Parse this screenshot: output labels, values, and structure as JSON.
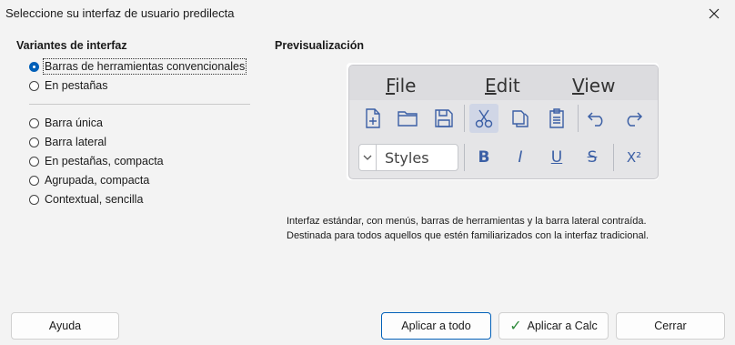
{
  "window": {
    "title": "Seleccione su interfaz de usuario predilecta"
  },
  "variants": {
    "heading": "Variantes de interfaz",
    "group1": [
      {
        "label": "Barras de herramientas convencionales",
        "checked": true
      },
      {
        "label": "En pestañas",
        "checked": false
      }
    ],
    "group2": [
      {
        "label": "Barra única",
        "checked": false
      },
      {
        "label": "Barra lateral",
        "checked": false
      },
      {
        "label": "En pestañas, compacta",
        "checked": false
      },
      {
        "label": "Agrupada, compacta",
        "checked": false
      },
      {
        "label": "Contextual, sencilla",
        "checked": false
      }
    ]
  },
  "preview": {
    "heading": "Previsualización",
    "menu": [
      {
        "underline": "F",
        "rest": "ile"
      },
      {
        "underline": "E",
        "rest": "dit"
      },
      {
        "underline": "V",
        "rest": "iew"
      }
    ],
    "toolbar_icons": [
      "new-document-icon",
      "open-folder-icon",
      "save-icon",
      "cut-icon",
      "copy-icon",
      "paste-icon",
      "undo-icon",
      "redo-icon"
    ],
    "styles_value": "Styles",
    "format": {
      "bold": "B",
      "italic": "I",
      "underline": "U",
      "strike": "S",
      "superscript": "X²"
    }
  },
  "description": {
    "line1": "Interfaz estándar, con menús, barras de herramientas y la barra lateral contraída.",
    "line2": "Destinada para todos aquellos que estén familiarizados con la interfaz tradicional."
  },
  "buttons": {
    "help": "Ayuda",
    "apply_all": "Aplicar a todo",
    "apply_calc": "Aplicar a Calc",
    "close": "Cerrar"
  },
  "colors": {
    "accent": "#005fb8",
    "icon": "#3b5fa5",
    "check": "#2e8a3a"
  }
}
